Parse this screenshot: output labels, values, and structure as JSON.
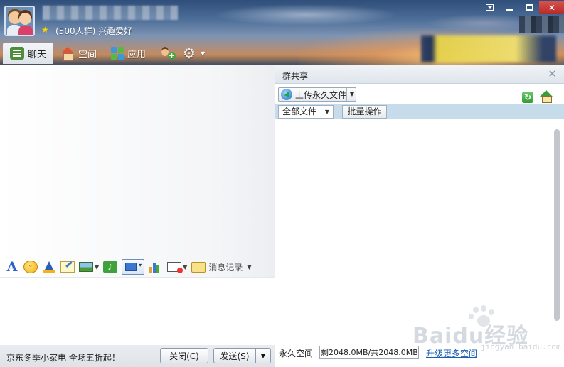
{
  "header": {
    "group_name_blurred": "",
    "group_info": "(500人群) 兴趣爱好",
    "window_controls": [
      "minimize-to-tray",
      "minimize",
      "maximize",
      "close"
    ]
  },
  "nav": {
    "tabs": [
      {
        "label": "聊天",
        "icon": "chat-icon",
        "active": true
      },
      {
        "label": "空间",
        "icon": "home-icon",
        "active": false
      },
      {
        "label": "应用",
        "icon": "apps-icon",
        "active": false
      }
    ]
  },
  "toolbar": {
    "message_history_label": "消息记录"
  },
  "footer": {
    "ad_text": "京东冬季小家电 全场五折起！",
    "close_label": "关闭(C)",
    "send_label": "发送(S)"
  },
  "share_panel": {
    "title": "群共享",
    "upload_label": "上传永久文件",
    "filter_label": "全部文件",
    "batch_label": "批量操作",
    "space_label": "永久空间",
    "space_value": "剩2048.0MB/共2048.0MB",
    "upgrade_link": "升级更多空间"
  },
  "watermark": {
    "text": "Baidu经验",
    "sub": "jingyan.baidu.com"
  },
  "colors": {
    "accent_blue": "#1a5fb4",
    "filter_bar": "#c6dceb",
    "close_red": "#c9302c"
  }
}
